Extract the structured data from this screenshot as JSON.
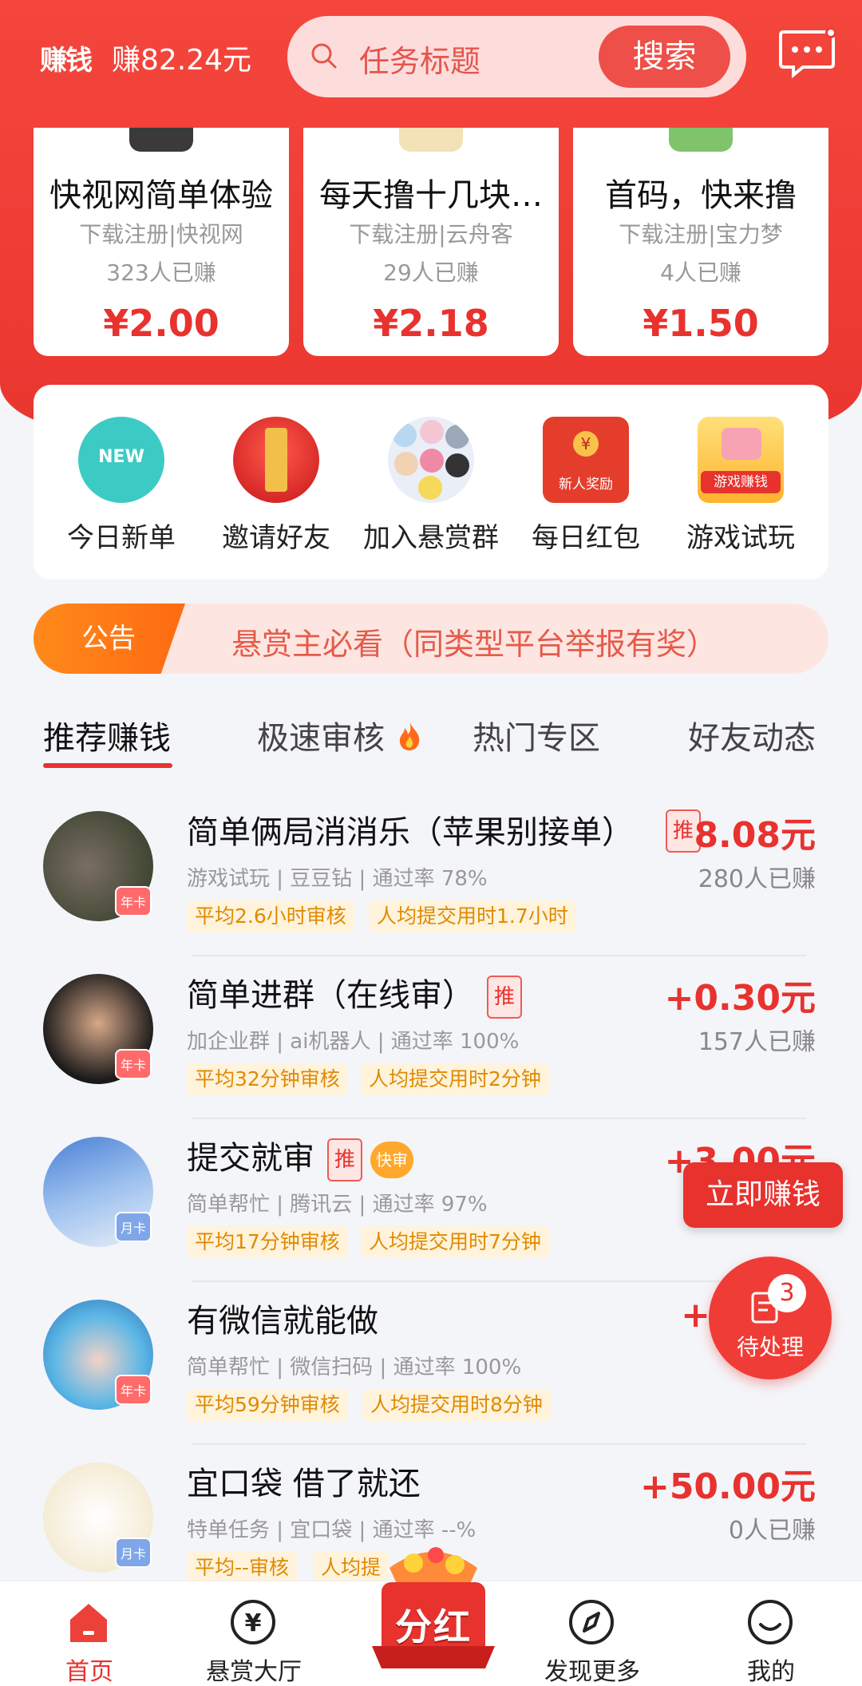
{
  "header": {
    "logo": "赚钱",
    "balance": "赚82.24元",
    "search_placeholder": "任务标题",
    "search_button": "搜索"
  },
  "top_cards": [
    {
      "title": "快视网简单体验",
      "meta": "下载注册|快视网",
      "count": "323人已赚",
      "price": "¥2.00"
    },
    {
      "title": "每天撸十几块…",
      "meta": "下载注册|云舟客",
      "count": "29人已赚",
      "price": "¥2.18"
    },
    {
      "title": "首码，快来撸",
      "meta": "下载注册|宝力梦",
      "count": "4人已赚",
      "price": "¥1.50"
    }
  ],
  "quick_menu": [
    {
      "label": "今日新单",
      "badge": "NEW"
    },
    {
      "label": "邀请好友"
    },
    {
      "label": "加入悬赏群"
    },
    {
      "label": "每日红包",
      "badge": "新人奖励"
    },
    {
      "label": "游戏试玩",
      "badge": "游戏赚钱"
    }
  ],
  "notice": {
    "tag": "公告",
    "text": "悬赏主必看（同类型平台举报有奖）"
  },
  "tabs": [
    "推荐赚钱",
    "极速审核",
    "热门专区",
    "好友动态"
  ],
  "tasks": [
    {
      "title": "简单俩局消消乐（苹果别接单）",
      "tag": "推",
      "meta": "游戏试玩 | 豆豆钻 | 通过率 78%",
      "chip1": "平均2.6小时审核",
      "chip2": "人均提交用时1.7小时",
      "price": "8.08元",
      "count": "280人已赚",
      "vip": "年卡"
    },
    {
      "title": "简单进群（在线审）",
      "tag": "推",
      "meta": "加企业群 | ai机器人 | 通过率 100%",
      "chip1": "平均32分钟审核",
      "chip2": "人均提交用时2分钟",
      "price": "+0.30元",
      "count": "157人已赚",
      "vip": "年卡"
    },
    {
      "title": "提交就审",
      "tag": "推",
      "tag2": "快审",
      "meta": "简单帮忙 | 腾讯云 | 通过率 97%",
      "chip1": "平均17分钟审核",
      "chip2": "人均提交用时7分钟",
      "price": "+3.00元",
      "count": "",
      "vip": "月卡"
    },
    {
      "title": "有微信就能做",
      "meta": "简单帮忙 | 微信扫码 | 通过率 100%",
      "chip1": "平均59分钟审核",
      "chip2": "人均提交用时8分钟",
      "price": "+",
      "count": "",
      "vip": "年卡"
    },
    {
      "title": "宜口袋 借了就还",
      "meta": "特单任务 | 宜口袋 | 通过率 --%",
      "chip1": "平均--审核",
      "chip2": "人均提",
      "price": "+50.00元",
      "count": "0人已赚",
      "vip": "月卡"
    }
  ],
  "floating": {
    "earn_now": "立即赚钱",
    "pending_label": "待处理",
    "pending_count": "3"
  },
  "bottom_nav": [
    "首页",
    "悬赏大厅",
    "分红",
    "发现更多",
    "我的"
  ],
  "colors": {
    "brand": "#e8322e",
    "chip_text": "#e08a00",
    "notice_tag": "#ff7a16"
  }
}
